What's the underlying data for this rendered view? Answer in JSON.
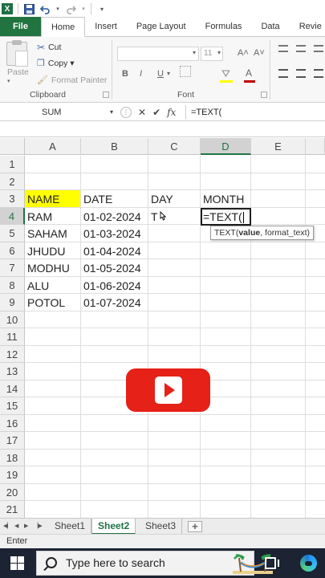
{
  "app": {
    "logo_letter": "X",
    "accent": "#217346"
  },
  "tabs": [
    "File",
    "Home",
    "Insert",
    "Page Layout",
    "Formulas",
    "Data",
    "Revie"
  ],
  "ribbon": {
    "paste_label": "Paste",
    "cut_label": "Cut",
    "copy_label": "Copy ▾",
    "format_painter_label": "Format Painter",
    "clipboard_label": "Clipboard",
    "font_size": "11",
    "font_label": "Font",
    "bold": "B",
    "italic": "I",
    "underline": "U",
    "grow_font": "A˄",
    "shrink_font": "A˅",
    "font_color": "A"
  },
  "formula_bar": {
    "name_box": "SUM",
    "cancel": "✕",
    "enter": "✔",
    "fx": "fx",
    "content": "=TEXT("
  },
  "grid": {
    "columns": [
      "A",
      "B",
      "C",
      "D",
      "E"
    ],
    "rows": [
      "1",
      "2",
      "3",
      "4",
      "5",
      "6",
      "7",
      "8",
      "9",
      "10",
      "11",
      "12",
      "13",
      "14",
      "15",
      "16",
      "17",
      "18",
      "19",
      "20",
      "21"
    ],
    "headers": {
      "a": "NAME",
      "b": "DATE",
      "c": "DAY",
      "d": "MONTH"
    },
    "data": [
      {
        "name": "RAM",
        "date": "01-02-2024",
        "day": "T"
      },
      {
        "name": "SAHAM",
        "date": "01-03-2024",
        "day": ""
      },
      {
        "name": "JHUDU",
        "date": "01-04-2024",
        "day": ""
      },
      {
        "name": "MODHU",
        "date": "01-05-2024",
        "day": ""
      },
      {
        "name": "ALU",
        "date": "01-06-2024",
        "day": ""
      },
      {
        "name": "POTOL",
        "date": "01-07-2024",
        "day": ""
      }
    ],
    "active_cell_text": "=TEXT(",
    "tooltip": {
      "func": "TEXT(",
      "arg_bold": "value",
      "rest": ", format_text)"
    }
  },
  "sheets": [
    "Sheet1",
    "Sheet2",
    "Sheet3"
  ],
  "status": "Enter",
  "taskbar": {
    "search_placeholder": "Type here to search"
  }
}
